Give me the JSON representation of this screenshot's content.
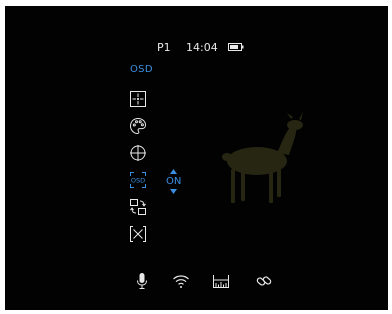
{
  "status_bar": {
    "profile": "P1",
    "time": "14:04",
    "battery_icon": "battery-icon"
  },
  "menu": {
    "title": "OSD",
    "accent_color": "#3b8fe0",
    "items": [
      {
        "icon": "reticle-icon"
      },
      {
        "icon": "palette-icon"
      },
      {
        "icon": "crosshair-icon"
      },
      {
        "icon": "osd-icon",
        "selected": true,
        "value": "ON"
      },
      {
        "icon": "pip-icon"
      },
      {
        "icon": "exit-icon"
      }
    ]
  },
  "bottom_bar": {
    "icons": [
      "microphone-icon",
      "wifi-icon",
      "rangefinder-icon",
      "link-icon"
    ]
  },
  "scene": {
    "subject": "deer-thermal-image"
  }
}
